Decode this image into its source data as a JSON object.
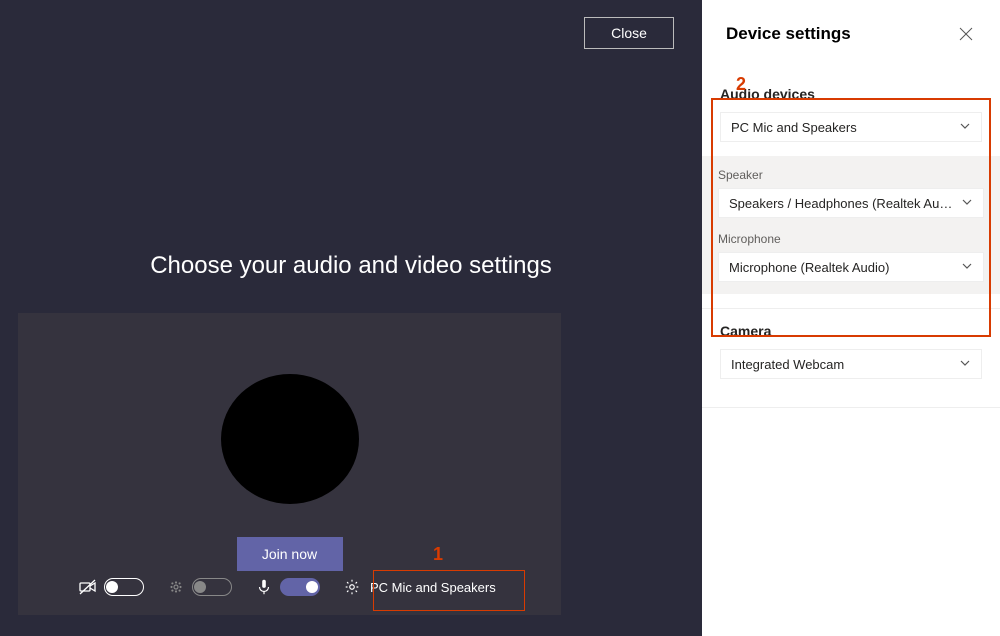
{
  "left": {
    "close_label": "Close",
    "heading": "Choose your audio and video settings",
    "join_label": "Join now",
    "device_button_label": "PC Mic and Speakers"
  },
  "right": {
    "title": "Device settings",
    "audio_devices_label": "Audio devices",
    "audio_devices_value": "PC Mic and Speakers",
    "speaker_label": "Speaker",
    "speaker_value": "Speakers / Headphones (Realtek Aud…",
    "microphone_label": "Microphone",
    "microphone_value": "Microphone (Realtek Audio)",
    "camera_label": "Camera",
    "camera_value": "Integrated Webcam"
  },
  "annotations": {
    "marker1": "1",
    "marker2": "2"
  }
}
